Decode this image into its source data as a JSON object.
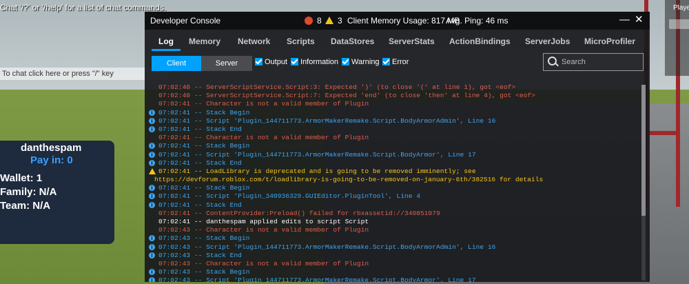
{
  "chat": {
    "hint": "Chat '/?' or '/help' for a list of chat commands.",
    "input_placeholder": "To chat click here or press \"/\" key"
  },
  "player_panel": {
    "name": "danthespam",
    "pay": "Pay in: 0",
    "wallet": "Wallet: 1",
    "family": "Family: N/A",
    "team": "Team: N/A"
  },
  "players_list": {
    "label": "Playe"
  },
  "console": {
    "title": "Developer Console",
    "error_count": "8",
    "warning_count": "3",
    "memory": "Client Memory Usage: 817 MB",
    "ping": "Avg. Ping: 46 ms",
    "minimize_glyph": "—",
    "close_glyph": "✕",
    "tabs": [
      "Log",
      "Memory",
      "Network",
      "Scripts",
      "DataStores",
      "ServerStats",
      "ActionBindings",
      "ServerJobs",
      "MicroProfiler"
    ],
    "active_tab": "Log",
    "client_label": "Client",
    "server_label": "Server",
    "filters": {
      "output": "Output",
      "information": "Information",
      "warning": "Warning",
      "error": "Error"
    },
    "search_placeholder": "Search",
    "lines": [
      {
        "type": "error",
        "text": "07:02:40 -- ServerScriptService.Script:3: Expected ')' (to close '(' at line 1), got <eof>"
      },
      {
        "type": "error",
        "text": "07:02:40 -- ServerScriptService.Script:7: Expected 'end' (to close 'then' at line 4), got <eof>"
      },
      {
        "type": "error",
        "text": "07:02:41 -- Character is not a valid member of Plugin"
      },
      {
        "type": "info",
        "text": "07:02:41 -- Stack Begin"
      },
      {
        "type": "info",
        "text": "07:02:41 -- Script 'Plugin_144711773.ArmorMakerRemake.Script.BodyArmorAdmin', Line 16"
      },
      {
        "type": "info",
        "text": "07:02:41 -- Stack End"
      },
      {
        "type": "error",
        "text": "07:02:41 -- Character is not a valid member of Plugin"
      },
      {
        "type": "info",
        "text": "07:02:41 -- Stack Begin"
      },
      {
        "type": "info",
        "text": "07:02:41 -- Script 'Plugin_144711773.ArmorMakerRemake.Script.BodyArmor', Line 17"
      },
      {
        "type": "info",
        "text": "07:02:41 -- Stack End"
      },
      {
        "type": "warning",
        "text": "07:02:41 -- LoadLibrary is deprecated and is going to be removed imminently; see"
      },
      {
        "type": "cont",
        "text": "https://devforum.roblox.com/t/loadlibrary-is-going-to-be-removed-on-january-6th/382516 for details"
      },
      {
        "type": "info",
        "text": "07:02:41 -- Stack Begin"
      },
      {
        "type": "info",
        "text": "07:02:41 -- Script 'Plugin_340936329.GUIEditor.PluginTool', Line 4"
      },
      {
        "type": "info",
        "text": "07:02:41 -- Stack End"
      },
      {
        "type": "error",
        "text": "07:02:41 -- ContentProvider:Preload() failed for rbxassetid://340851079"
      },
      {
        "type": "output",
        "text": "07:02:41 -- danthespam applied edits to script Script"
      },
      {
        "type": "error",
        "text": "07:02:43 -- Character is not a valid member of Plugin"
      },
      {
        "type": "info",
        "text": "07:02:43 -- Stack Begin"
      },
      {
        "type": "info",
        "text": "07:02:43 -- Script 'Plugin_144711773.ArmorMakerRemake.Script.BodyArmorAdmin', Line 16"
      },
      {
        "type": "info",
        "text": "07:02:43 -- Stack End"
      },
      {
        "type": "error",
        "text": "07:02:43 -- Character is not a valid member of Plugin"
      },
      {
        "type": "info",
        "text": "07:02:43 -- Stack Begin"
      },
      {
        "type": "info",
        "text": "07:02:43 -- Script 'Plugin_144711773.ArmorMakerRemake.Script.BodyArmor', Line 17"
      }
    ]
  },
  "colors": {
    "accent": "#00a2ff",
    "error": "#e35d4f",
    "info": "#3fa5f0",
    "warning": "#f5c518"
  }
}
